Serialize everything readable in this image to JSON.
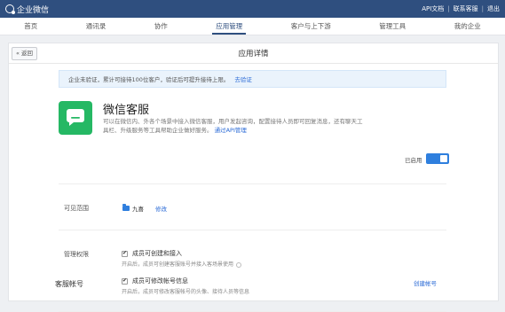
{
  "topbar": {
    "brand": "企业微信",
    "links": [
      "API文档",
      "联系客服",
      "退出"
    ]
  },
  "nav": [
    "首页",
    "通讯录",
    "协作",
    "应用管理",
    "客户与上下游",
    "管理工具",
    "我的企业"
  ],
  "card": {
    "back_label": "« 返回",
    "title": "应用详情"
  },
  "notice": {
    "text": "企业未验证，累计可接待100位客户，验证后可提升接待上限。",
    "link": "去验证"
  },
  "app": {
    "name": "微信客服",
    "desc_line1": "可以在微信内、外各个场景中接入微信客服，用户发起咨询，配置接待人员即可回复消息，还有聊天工",
    "desc_line2": "具栏、升级服务等工具帮助企业做好服务。",
    "desc_link": "通过API管理",
    "status": "已启用",
    "enabled": true
  },
  "scope": {
    "label": "可见范围",
    "value": "九喜",
    "edit": "修改"
  },
  "permissions": {
    "label": "管理权限",
    "items": [
      {
        "title": "成员可创建和接入",
        "sub": "开启后，成员可创建客服账号并接入客场景使用",
        "checked": true
      },
      {
        "title": "成员可修改帐号信息",
        "sub": "开启后，成员可修改客服帐号的头像、接待人员等信息",
        "checked": true
      }
    ]
  },
  "accounts": {
    "title": "客服帐号",
    "create": "创建帐号"
  },
  "colors": {
    "topbar": "#2f4f7f",
    "accent": "#2f7fde",
    "app_icon": "#25b864",
    "link": "#2a6ad6"
  }
}
